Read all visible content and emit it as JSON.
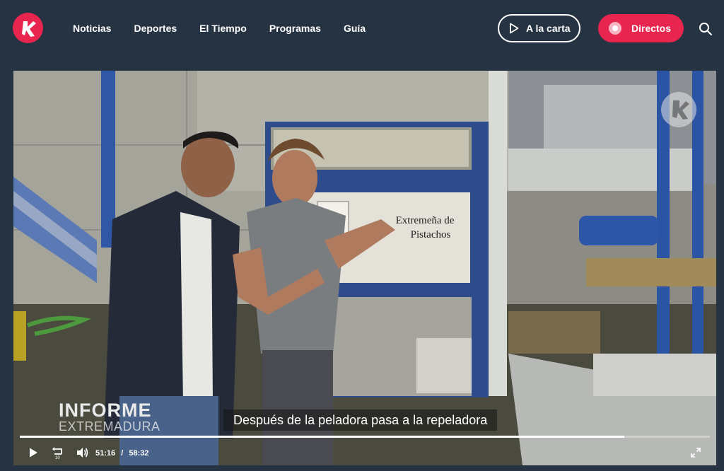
{
  "header": {
    "logo_icon": "canal-extremadura-logo-icon",
    "nav": [
      "Noticias",
      "Deportes",
      "El Tiempo",
      "Programas",
      "Guía"
    ],
    "a_la_carta_label": "A la carta",
    "directos_label": "Directos",
    "search_icon": "search-icon",
    "accent_color": "#e8254f",
    "background_color": "#253342"
  },
  "player": {
    "show_logo_line1": "INFORME",
    "show_logo_line2": "EXTREMADURA",
    "subtitle": "Después de la peladora pasa a la repeladora",
    "current_time": "51:16",
    "separator": "/",
    "duration": "58:32",
    "progress_fraction": 0.876,
    "machine_label_line1": "Extremeña de",
    "machine_label_line2": "Pistachos",
    "controls": [
      "play-icon",
      "replay-10-icon",
      "volume-icon",
      "fullscreen-icon"
    ]
  }
}
